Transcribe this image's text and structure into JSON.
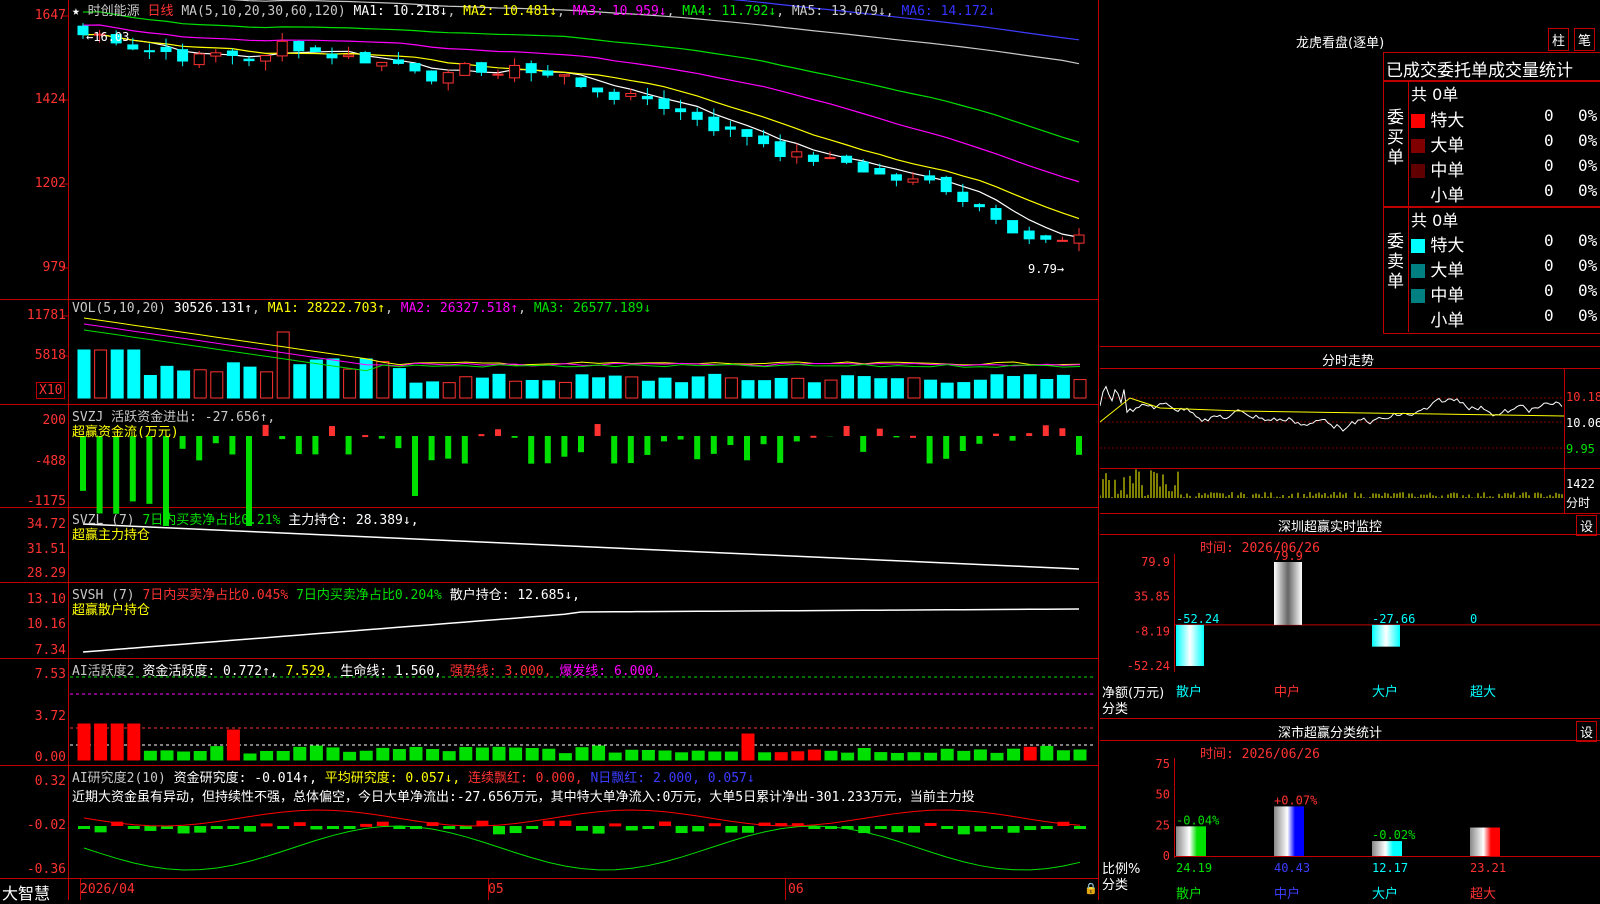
{
  "title": {
    "star": "★",
    "stock": "时创能源",
    "period": "日线",
    "ma_label": "MA(5,10,20,30,60,120)",
    "ma": [
      {
        "t": "MA1: 10.218↓",
        "c": "#ffffff"
      },
      {
        "t": "MA2: 10.481↓",
        "c": "#ffff00"
      },
      {
        "t": "MA3: 10.959↓",
        "c": "#ff00ff"
      },
      {
        "t": "MA4: 11.792↓",
        "c": "#00e000"
      },
      {
        "t": "MA5: 13.079↓",
        "c": "#c8c8c8"
      },
      {
        "t": "MA6: 14.172↓",
        "c": "#3c3cff"
      }
    ]
  },
  "price_axis": [
    "1647",
    "1424",
    "1202",
    "979"
  ],
  "price_marks": {
    "high": "16.03",
    "low": "9.79"
  },
  "vol": {
    "label": "VOL(5,10,20)",
    "value": "30526.131↑",
    "ma1": "MA1: 28222.703↑",
    "ma2": "MA2: 26327.518↑",
    "ma3": "MA3: 26577.189↓",
    "axis": [
      "11781",
      "5818"
    ],
    "unit": "X10"
  },
  "svzj": {
    "label": "SVZJ  活跃资金进出: -27.656↑,",
    "sub": "超赢资金流(万元)",
    "axis": [
      "200",
      "-488",
      "-1175"
    ]
  },
  "svzl": {
    "label": "SVZL (7)",
    "t1": "7日内买卖净占比0.21%",
    "t2": "主力持仓: 28.389↓,",
    "sub": "超赢主力持仓",
    "axis": [
      "34.72",
      "31.51",
      "28.29"
    ]
  },
  "svsh": {
    "label": "SVSH (7)",
    "t1": "7日内买卖净占比0.045%",
    "t2": "7日内买卖净占比0.204%",
    "t3": "散户持仓: 12.685↓,",
    "sub": "超赢散户持仓",
    "axis": [
      "13.10",
      "10.16",
      "7.34"
    ]
  },
  "ai1": {
    "label": "AI活跃度2",
    "t1": "资金活跃度: 0.772↑,",
    "t2": "7.529,",
    "t3": "生命线: 1.560,",
    "t4": "强势线: 3.000,",
    "t5": "爆发线: 6.000,",
    "axis": [
      "7.53",
      "3.72",
      "0.00"
    ]
  },
  "ai2": {
    "label": "AI研究度2(10)",
    "t1": "资金研究度: -0.014↑,",
    "t2": "平均研究度: 0.057↓,",
    "t3": "连续飘红: 0.000,",
    "t4": "N日飘红: 2.000,",
    "t5": "0.057↓",
    "comment": "近期大资金虽有异动，但持续性不强，总体偏空，今日大单净流出:-27.656万元，其中特大单净流入:0万元，大单5日累计净出-301.233万元，当前主力投",
    "axis": [
      "0.32",
      "-0.02",
      "-0.36"
    ]
  },
  "bottom": {
    "brand": "大智慧",
    "date": "2026/04",
    "m1": "05",
    "m2": "06"
  },
  "lhb": {
    "title": "龙虎看盘(逐单)",
    "btn1": "柱",
    "btn2": "笔",
    "tabs": "已成交委托单成交量统计",
    "buy_title": "委买单",
    "buy_total": "共 0单",
    "buy": [
      {
        "n": "特大",
        "v": "0",
        "p": "0%",
        "c": "#ff0000"
      },
      {
        "n": "大单",
        "v": "0",
        "p": "0%",
        "c": "#800000"
      },
      {
        "n": "中单",
        "v": "0",
        "p": "0%",
        "c": "#600000"
      },
      {
        "n": "小单",
        "v": "0",
        "p": "0%",
        "c": "#000000"
      }
    ],
    "sell_title": "委卖单",
    "sell_total": "共 0单",
    "sell": [
      {
        "n": "特大",
        "v": "0",
        "p": "0%",
        "c": "#00ffff"
      },
      {
        "n": "大单",
        "v": "0",
        "p": "0%",
        "c": "#008080"
      },
      {
        "n": "中单",
        "v": "0",
        "p": "0%",
        "c": "#008080"
      },
      {
        "n": "小单",
        "v": "0",
        "p": "0%",
        "c": "#000000"
      }
    ]
  },
  "fenshi": {
    "title": "分时走势",
    "axis": [
      "10.18",
      "10.06",
      "9.95"
    ],
    "vol": "1422",
    "vollabel": "分时"
  },
  "monitor": {
    "title": "深圳超赢实时监控",
    "btn": "设",
    "time": "时间: 2026/06/26",
    "axis": [
      "79.9",
      "35.85",
      "-8.19",
      "-52.24"
    ],
    "ylabel": "净额(万元)",
    "xlabel": "分类",
    "vals": [
      "-52.24",
      "79.9",
      "-27.66",
      "0"
    ],
    "cats": [
      "散户",
      "中户",
      "大户",
      "超大"
    ]
  },
  "classify": {
    "title": "深市超赢分类统计",
    "btn": "设",
    "time": "时间: 2026/06/26",
    "axis": [
      "75",
      "50",
      "25",
      "0"
    ],
    "ylabel": "比例%",
    "xlabel": "分类",
    "changes": [
      "-0.04%",
      "+0.07%",
      "-0.02%",
      ""
    ],
    "vals": [
      "24.19",
      "40.43",
      "12.17",
      "23.21"
    ],
    "cats": [
      "散户",
      "中户",
      "大户",
      "超大"
    ]
  }
}
